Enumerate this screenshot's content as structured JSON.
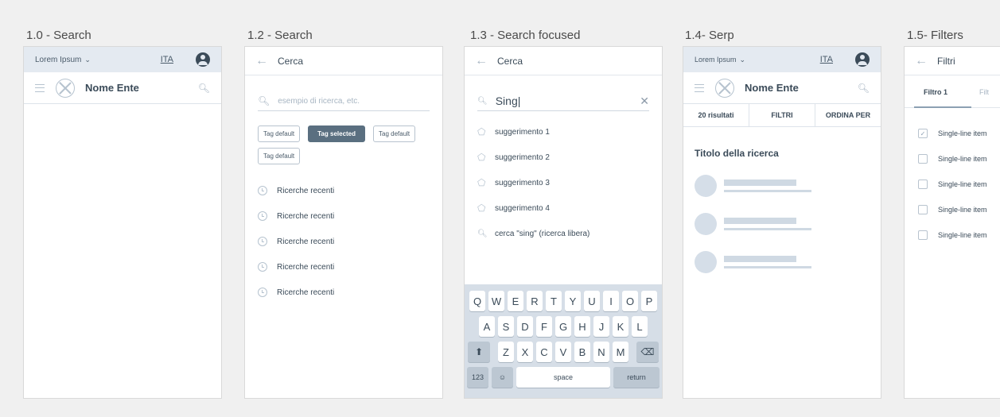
{
  "frames": [
    {
      "title": "1.0 - Search"
    },
    {
      "title": "1.2 - Search"
    },
    {
      "title": "1.3 - Search focused"
    },
    {
      "title": "1.4- Serp"
    },
    {
      "title": "1.5- Filters"
    }
  ],
  "topbar": {
    "label": "Lorem Ipsum",
    "caret": "⌄",
    "lang": "ITA"
  },
  "header": {
    "brand": "Nome Ente"
  },
  "search": {
    "back_title": "Cerca",
    "placeholder": "esempio di ricerca, etc.",
    "tags": [
      "Tag default",
      "Tag selected",
      "Tag default",
      "Tag default"
    ],
    "recent": [
      "Ricerche recenti",
      "Ricerche recenti",
      "Ricerche recenti",
      "Ricerche recenti",
      "Ricerche recenti"
    ]
  },
  "focused": {
    "back_title": "Cerca",
    "value": "Sing|",
    "suggestions": [
      "suggerimento 1",
      "suggerimento 2",
      "suggerimento 3",
      "suggerimento 4"
    ],
    "free_search": "cerca \"sing\" (ricerca libera)"
  },
  "keyboard": {
    "row1": [
      "Q",
      "W",
      "E",
      "R",
      "T",
      "Y",
      "U",
      "I",
      "O",
      "P"
    ],
    "row2": [
      "A",
      "S",
      "D",
      "F",
      "G",
      "H",
      "J",
      "K",
      "L"
    ],
    "row3": [
      "Z",
      "X",
      "C",
      "V",
      "B",
      "N",
      "M"
    ],
    "num": "123",
    "space": "space",
    "return": "return"
  },
  "serp": {
    "results": "20 risultati",
    "filters": "FILTRI",
    "order": "ORDINA PER",
    "title": "Titolo della ricerca"
  },
  "filters": {
    "back_title": "Filtri",
    "tab1": "Filtro 1",
    "tab2": "Filt",
    "items": [
      "Single-line item",
      "Single-line item",
      "Single-line item",
      "Single-line item",
      "Single-line item"
    ],
    "checked": [
      true,
      false,
      false,
      false,
      false
    ]
  }
}
